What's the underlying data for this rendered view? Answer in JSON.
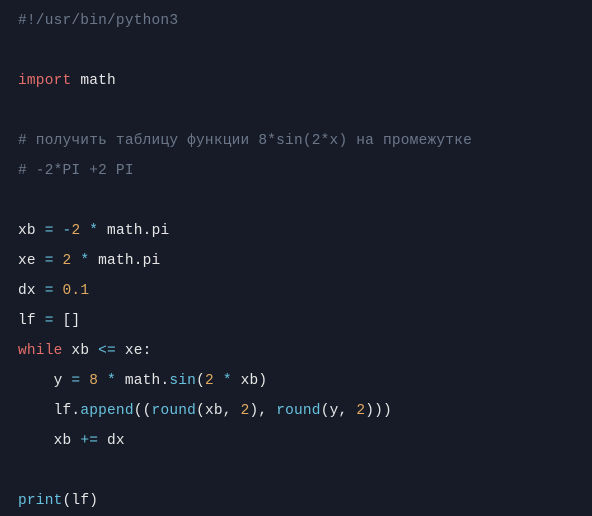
{
  "code": {
    "lines": [
      [
        {
          "cls": "c-comment",
          "t": "#!/usr/bin/python3"
        }
      ],
      [
        {
          "cls": "c-default",
          "t": ""
        }
      ],
      [
        {
          "cls": "c-keyword",
          "t": "import"
        },
        {
          "cls": "c-default",
          "t": " math"
        }
      ],
      [
        {
          "cls": "c-default",
          "t": ""
        }
      ],
      [
        {
          "cls": "c-comment",
          "t": "# получить таблицу функции 8*sin(2*x) на промежутке"
        }
      ],
      [
        {
          "cls": "c-comment",
          "t": "# -2*PI +2 PI"
        }
      ],
      [
        {
          "cls": "c-default",
          "t": ""
        }
      ],
      [
        {
          "cls": "c-default",
          "t": "xb "
        },
        {
          "cls": "c-operator",
          "t": "="
        },
        {
          "cls": "c-default",
          "t": " "
        },
        {
          "cls": "c-operator",
          "t": "-"
        },
        {
          "cls": "c-number",
          "t": "2"
        },
        {
          "cls": "c-default",
          "t": " "
        },
        {
          "cls": "c-operator",
          "t": "*"
        },
        {
          "cls": "c-default",
          "t": " math.pi"
        }
      ],
      [
        {
          "cls": "c-default",
          "t": "xe "
        },
        {
          "cls": "c-operator",
          "t": "="
        },
        {
          "cls": "c-default",
          "t": " "
        },
        {
          "cls": "c-number",
          "t": "2"
        },
        {
          "cls": "c-default",
          "t": " "
        },
        {
          "cls": "c-operator",
          "t": "*"
        },
        {
          "cls": "c-default",
          "t": " math.pi"
        }
      ],
      [
        {
          "cls": "c-default",
          "t": "dx "
        },
        {
          "cls": "c-operator",
          "t": "="
        },
        {
          "cls": "c-default",
          "t": " "
        },
        {
          "cls": "c-number",
          "t": "0.1"
        }
      ],
      [
        {
          "cls": "c-default",
          "t": "lf "
        },
        {
          "cls": "c-operator",
          "t": "="
        },
        {
          "cls": "c-default",
          "t": " []"
        }
      ],
      [
        {
          "cls": "c-keyword",
          "t": "while"
        },
        {
          "cls": "c-default",
          "t": " xb "
        },
        {
          "cls": "c-operator",
          "t": "<="
        },
        {
          "cls": "c-default",
          "t": " xe:"
        }
      ],
      [
        {
          "cls": "c-default",
          "t": "    y "
        },
        {
          "cls": "c-operator",
          "t": "="
        },
        {
          "cls": "c-default",
          "t": " "
        },
        {
          "cls": "c-number",
          "t": "8"
        },
        {
          "cls": "c-default",
          "t": " "
        },
        {
          "cls": "c-operator",
          "t": "*"
        },
        {
          "cls": "c-default",
          "t": " math."
        },
        {
          "cls": "c-func",
          "t": "sin"
        },
        {
          "cls": "c-default",
          "t": "("
        },
        {
          "cls": "c-number",
          "t": "2"
        },
        {
          "cls": "c-default",
          "t": " "
        },
        {
          "cls": "c-operator",
          "t": "*"
        },
        {
          "cls": "c-default",
          "t": " xb)"
        }
      ],
      [
        {
          "cls": "c-default",
          "t": "    lf."
        },
        {
          "cls": "c-func",
          "t": "append"
        },
        {
          "cls": "c-default",
          "t": "(("
        },
        {
          "cls": "c-func",
          "t": "round"
        },
        {
          "cls": "c-default",
          "t": "(xb, "
        },
        {
          "cls": "c-number",
          "t": "2"
        },
        {
          "cls": "c-default",
          "t": "), "
        },
        {
          "cls": "c-func",
          "t": "round"
        },
        {
          "cls": "c-default",
          "t": "(y, "
        },
        {
          "cls": "c-number",
          "t": "2"
        },
        {
          "cls": "c-default",
          "t": ")))"
        }
      ],
      [
        {
          "cls": "c-default",
          "t": "    xb "
        },
        {
          "cls": "c-operator",
          "t": "+="
        },
        {
          "cls": "c-default",
          "t": " dx"
        }
      ],
      [
        {
          "cls": "c-default",
          "t": ""
        }
      ],
      [
        {
          "cls": "c-func",
          "t": "print"
        },
        {
          "cls": "c-default",
          "t": "(lf)"
        }
      ]
    ]
  }
}
